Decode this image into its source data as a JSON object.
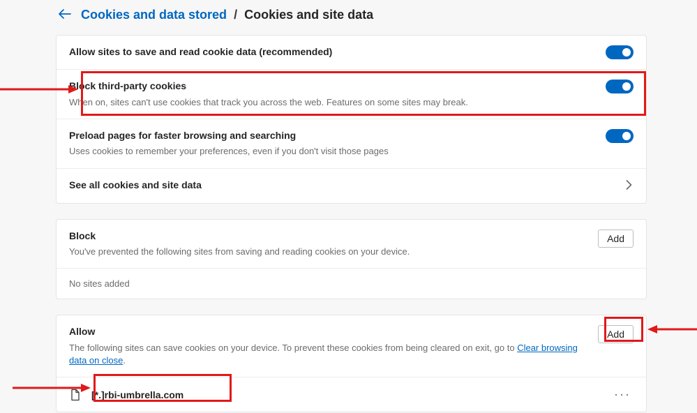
{
  "breadcrumb": {
    "link": "Cookies and data stored",
    "current": "Cookies and site data"
  },
  "settings": {
    "allow_save": {
      "title": "Allow sites to save and read cookie data (recommended)"
    },
    "block_third_party": {
      "title": "Block third-party cookies",
      "sub": "When on, sites can't use cookies that track you across the web. Features on some sites may break."
    },
    "preload": {
      "title": "Preload pages for faster browsing and searching",
      "sub": "Uses cookies to remember your preferences, even if you don't visit those pages"
    },
    "see_all": {
      "title": "See all cookies and site data"
    }
  },
  "block_section": {
    "title": "Block",
    "sub": "You've prevented the following sites from saving and reading cookies on your device.",
    "add_label": "Add",
    "empty": "No sites added"
  },
  "allow_section": {
    "title": "Allow",
    "sub_before": "The following sites can save cookies on your device. To prevent these cookies from being cleared on exit, go to ",
    "link": "Clear browsing data on close",
    "sub_after": ".",
    "add_label": "Add",
    "sites": [
      {
        "name": "[*.]rbi-umbrella.com"
      }
    ]
  }
}
